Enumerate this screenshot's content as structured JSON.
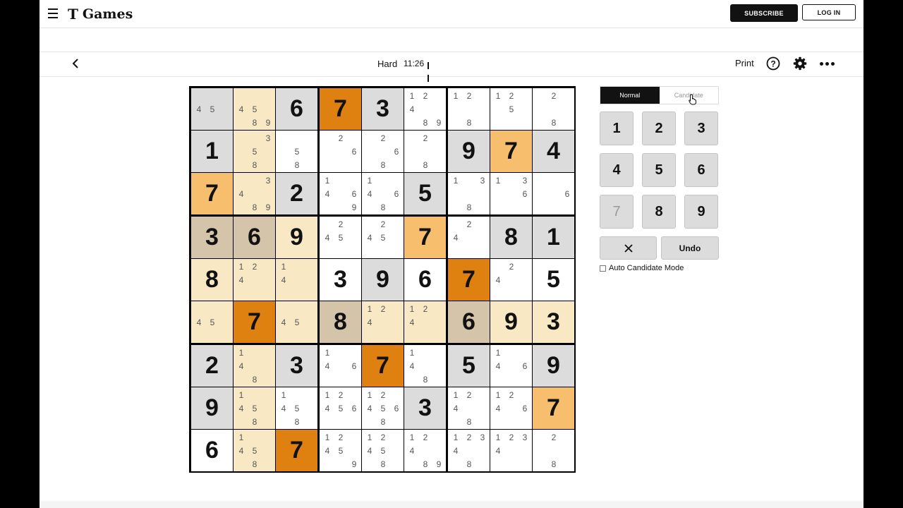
{
  "header": {
    "logo_mark": "T",
    "logo_text": "Games",
    "subscribe": "SUBSCRIBE",
    "login": "LOG IN"
  },
  "toolbar": {
    "difficulty": "Hard",
    "timer": "11:26",
    "print": "Print"
  },
  "colors": {
    "value_cell": "#dcdcdc",
    "highlight_light": "#f8e8c4",
    "highlight_mid": "#d4c5aa",
    "highlight_strong": "#f7be6d",
    "selected_seven": "#de8110"
  },
  "grid": {
    "values": [
      [
        0,
        0,
        6,
        7,
        3,
        0,
        0,
        0,
        0
      ],
      [
        1,
        0,
        0,
        0,
        0,
        0,
        9,
        7,
        4
      ],
      [
        7,
        0,
        2,
        0,
        0,
        5,
        0,
        0,
        0
      ],
      [
        3,
        6,
        9,
        0,
        0,
        7,
        0,
        8,
        1
      ],
      [
        8,
        0,
        0,
        3,
        9,
        6,
        7,
        0,
        5
      ],
      [
        0,
        7,
        0,
        8,
        0,
        0,
        6,
        9,
        3
      ],
      [
        2,
        0,
        3,
        0,
        7,
        0,
        5,
        0,
        9
      ],
      [
        9,
        0,
        0,
        0,
        0,
        3,
        0,
        0,
        7
      ],
      [
        6,
        0,
        7,
        0,
        0,
        0,
        0,
        0,
        0
      ]
    ],
    "candidates": [
      [
        [
          4,
          5
        ],
        [
          4,
          5,
          8,
          9
        ],
        [],
        [],
        [],
        [
          1,
          2,
          4,
          8,
          9
        ],
        [
          1,
          2,
          8
        ],
        [
          1,
          2,
          5
        ],
        [
          2,
          8
        ]
      ],
      [
        [],
        [
          3,
          5,
          8
        ],
        [
          5,
          8
        ],
        [
          2,
          6
        ],
        [
          2,
          6,
          8
        ],
        [
          2,
          8
        ],
        [],
        [],
        []
      ],
      [
        [],
        [
          3,
          4,
          8,
          9
        ],
        [],
        [
          1,
          4,
          6,
          9
        ],
        [
          1,
          4,
          6,
          8
        ],
        [],
        [
          1,
          3,
          8
        ],
        [
          1,
          3,
          6
        ],
        [
          6
        ]
      ],
      [
        [],
        [],
        [],
        [
          2,
          4,
          5
        ],
        [
          2,
          4,
          5
        ],
        [],
        [
          2,
          4
        ],
        [],
        []
      ],
      [
        [],
        [
          1,
          2,
          4
        ],
        [
          1,
          4
        ],
        [],
        [],
        [],
        [],
        [
          2,
          4
        ],
        []
      ],
      [
        [
          4,
          5
        ],
        [],
        [
          4,
          5
        ],
        [],
        [
          1,
          2,
          4
        ],
        [
          1,
          2,
          4
        ],
        [],
        [],
        []
      ],
      [
        [],
        [
          1,
          4,
          8
        ],
        [],
        [
          1,
          4,
          6
        ],
        [],
        [
          1,
          4,
          8
        ],
        [],
        [
          1,
          4,
          6
        ],
        []
      ],
      [
        [],
        [
          1,
          4,
          5,
          8
        ],
        [
          1,
          4,
          5,
          8
        ],
        [
          1,
          2,
          4,
          5,
          6
        ],
        [
          1,
          2,
          4,
          5,
          6,
          8
        ],
        [],
        [
          1,
          2,
          4,
          8
        ],
        [
          1,
          2,
          4,
          6
        ],
        []
      ],
      [
        [],
        [
          1,
          4,
          5,
          8
        ],
        [],
        [
          1,
          2,
          4,
          5,
          9
        ],
        [
          1,
          2,
          4,
          5,
          8
        ],
        [
          1,
          2,
          4,
          8,
          9
        ],
        [
          1,
          2,
          3,
          4,
          8
        ],
        [
          1,
          2,
          3,
          4
        ],
        [
          2,
          8
        ]
      ]
    ],
    "highlights": [
      "V",
      "L",
      "V",
      "O",
      "V",
      "W",
      "W",
      "W",
      "W",
      "V",
      "L",
      "W",
      "W",
      "W",
      "W",
      "V",
      "M",
      "V",
      "M",
      "L",
      "V",
      "W",
      "W",
      "V",
      "W",
      "W",
      "W",
      "T",
      "T",
      "L",
      "W",
      "W",
      "M",
      "W",
      "V",
      "V",
      "L",
      "L",
      "L",
      "W",
      "V",
      "W",
      "O",
      "W",
      "W",
      "L",
      "O",
      "L",
      "T",
      "L",
      "L",
      "T",
      "L",
      "L",
      "V",
      "L",
      "V",
      "W",
      "O",
      "W",
      "V",
      "W",
      "V",
      "V",
      "L",
      "W",
      "W",
      "W",
      "V",
      "W",
      "W",
      "M",
      "W",
      "L",
      "O",
      "W",
      "W",
      "W",
      "W",
      "W",
      "W"
    ]
  },
  "controls": {
    "mode_normal": "Normal",
    "mode_candidate": "Candidate",
    "keys": [
      "1",
      "2",
      "3",
      "4",
      "5",
      "6",
      "7",
      "8",
      "9"
    ],
    "dim_key": "7",
    "undo": "Undo",
    "auto_candidate": "Auto Candidate Mode"
  }
}
